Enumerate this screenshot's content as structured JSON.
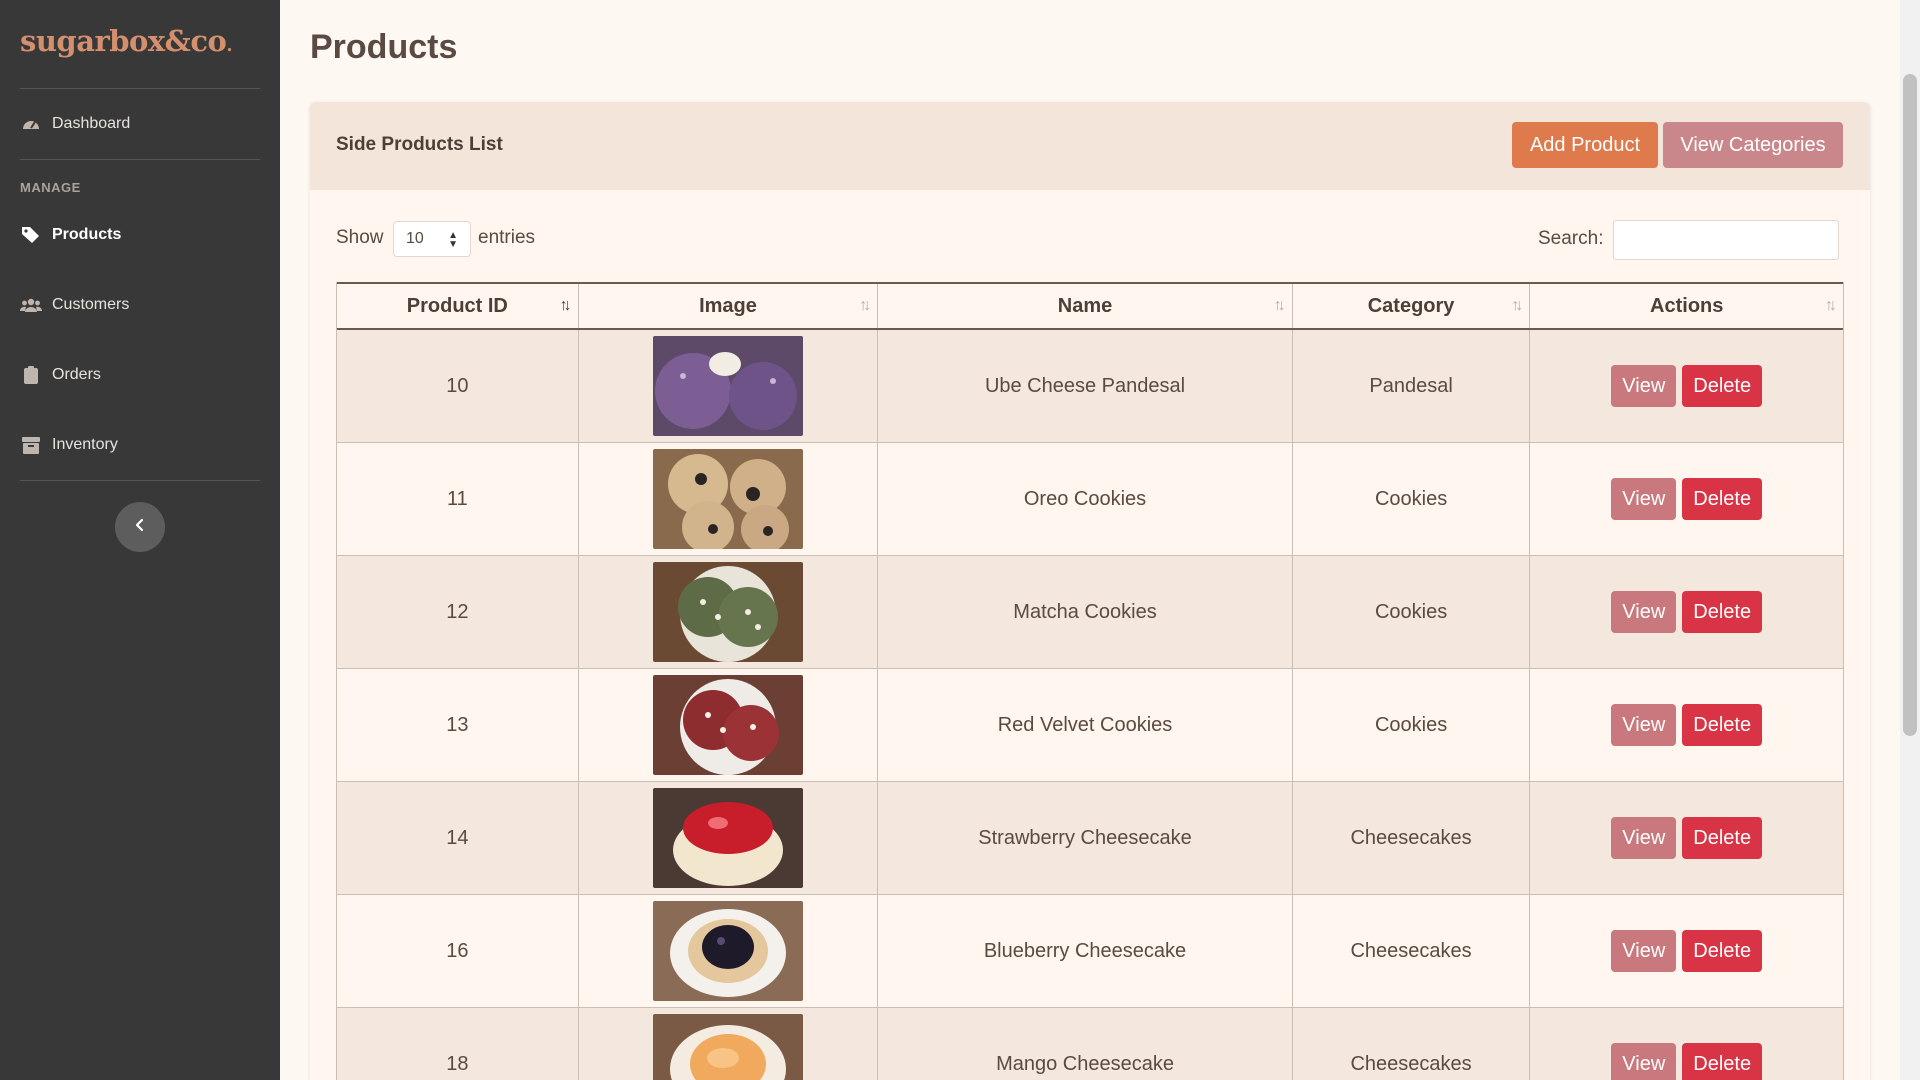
{
  "brand": {
    "name": "sugarbox&co",
    "dot": "."
  },
  "sidebar": {
    "items": [
      {
        "label": "Dashboard",
        "icon": "gauge-icon"
      },
      {
        "label": "Products",
        "icon": "tags-icon"
      },
      {
        "label": "Customers",
        "icon": "users-icon"
      },
      {
        "label": "Orders",
        "icon": "clipboard-icon"
      },
      {
        "label": "Inventory",
        "icon": "box-icon"
      }
    ],
    "section": "MANAGE",
    "active": "Products"
  },
  "page": {
    "title": "Products"
  },
  "card": {
    "title": "Side Products List",
    "add_button": "Add Product",
    "categories_button": "View Categories"
  },
  "table_controls": {
    "show_label": "Show",
    "entries_value": "10",
    "entries_label": "entries",
    "search_label": "Search:",
    "search_value": ""
  },
  "table": {
    "columns": [
      "Product ID",
      "Image",
      "Name",
      "Category",
      "Actions"
    ],
    "sorted_column": "Product ID",
    "rows": [
      {
        "id": "10",
        "name": "Ube Cheese Pandesal",
        "category": "Pandesal",
        "image": "ube-pandesal-photo"
      },
      {
        "id": "11",
        "name": "Oreo Cookies",
        "category": "Cookies",
        "image": "oreo-cookies-photo"
      },
      {
        "id": "12",
        "name": "Matcha Cookies",
        "category": "Cookies",
        "image": "matcha-cookies-photo"
      },
      {
        "id": "13",
        "name": "Red Velvet Cookies",
        "category": "Cookies",
        "image": "red-velvet-cookies-photo"
      },
      {
        "id": "14",
        "name": "Strawberry Cheesecake",
        "category": "Cheesecakes",
        "image": "strawberry-cheesecake-photo"
      },
      {
        "id": "16",
        "name": "Blueberry Cheesecake",
        "category": "Cheesecakes",
        "image": "blueberry-cheesecake-photo"
      },
      {
        "id": "18",
        "name": "Mango Cheesecake",
        "category": "Cheesecakes",
        "image": "mango-cheesecake-photo"
      }
    ],
    "view_label": "View",
    "delete_label": "Delete"
  },
  "colors": {
    "sidebar_bg": "#383838",
    "accent_orange": "#df7a4d",
    "accent_rose": "#c9878c",
    "delete_red": "#d93445",
    "page_bg": "#fdf8f1"
  }
}
